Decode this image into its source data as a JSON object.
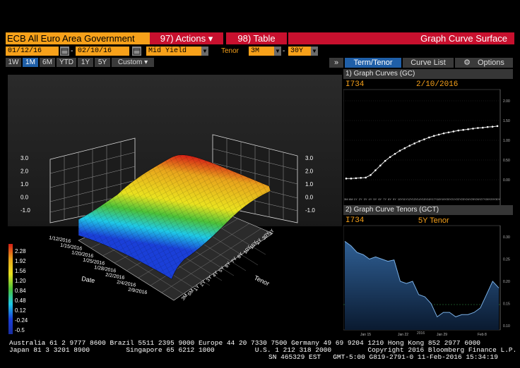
{
  "toolbar": {
    "security": "ECB All Euro Area Government",
    "actions_label": "97) Actions ▾",
    "table_label": "98) Table",
    "title": "Graph Curve Surface"
  },
  "params": {
    "start_date": "01/12/16",
    "end_date": "02/10/16",
    "field": "Mid Yield",
    "tenor_label": "Tenor",
    "tenor_from": "3M",
    "tenor_to": "30Y"
  },
  "periods": [
    "1W",
    "1M",
    "6M",
    "YTD",
    "1Y",
    "5Y",
    "Custom ▾"
  ],
  "active_period": "1M",
  "right_tabs": {
    "collapse": "»",
    "term_tenor": "Term/Tenor",
    "curve_list": "Curve List",
    "options": "Options"
  },
  "panel1": {
    "header": "1) Graph Curves (GC)",
    "curve": "I734",
    "date": "2/10/2016",
    "y_ticks": [
      "2.00",
      "1.50",
      "1.00",
      "0.50",
      "0.00"
    ],
    "x_ticks": [
      "3M",
      "6M",
      "1Y",
      "2Y",
      "3Y",
      "4Y",
      "5Y",
      "6Y",
      "7Y",
      "8Y",
      "9Y",
      "10Y",
      "11Y",
      "12Y",
      "13Y",
      "14Y",
      "15Y",
      "16Y",
      "17Y",
      "18Y",
      "19Y",
      "20Y",
      "21Y",
      "22Y",
      "23Y",
      "24Y",
      "25Y",
      "26Y",
      "27Y",
      "28Y",
      "29Y",
      "30Y"
    ]
  },
  "panel2": {
    "header": "2) Graph Curve Tenors (GCT)",
    "curve": "I734",
    "tenor": "5Y Tenor",
    "y_ticks": [
      "0.30",
      "0.25",
      "0.20",
      "0.15",
      "0.10"
    ],
    "x_ticks": [
      "Jan 15",
      "Jan 22",
      "Jan 29",
      "Feb 8"
    ],
    "year_label": "2016"
  },
  "surface": {
    "z_ticks": [
      "3.0",
      "2.0",
      "1.0",
      "0.0",
      "-1.0"
    ],
    "date_ticks": [
      "1/12/2016",
      "1/15/2016",
      "1/20/2016",
      "1/25/2016",
      "1/28/2016",
      "2/2/2016",
      "2/4/2016",
      "2/9/2016"
    ],
    "date_axis_label": "Date",
    "tenor_ticks": [
      "3Y",
      "30Y",
      "2Y",
      "15Y",
      "10Y",
      "8Y",
      "7Y",
      "6Y",
      "5Y",
      "4Y",
      "3Y",
      "2Y",
      "1Y",
      "6M",
      "3M"
    ],
    "tenor_axis_label": "Tenor",
    "legend": [
      "2.28",
      "1.92",
      "1.56",
      "1.20",
      "0.84",
      "0.48",
      "0.12",
      "-0.24",
      "-0.5"
    ],
    "colors": {
      "high": "#d51e16",
      "mid_high": "#e9e21f",
      "mid": "#4cc23a",
      "mid_low": "#1fc9e6",
      "low": "#1a3fd8"
    }
  },
  "footer": {
    "line1": "Australia 61 2 9777 8600 Brazil 5511 2395 9000 Europe 44 20 7330 7500 Germany 49 69 9204 1210 Hong Kong 852 2977 6000",
    "line2": "Japan 81 3 3201 8900         Singapore 65 6212 1000          U.S. 1 212 318 2000         Copyright 2016 Bloomberg Finance L.P.",
    "line3": "SN 465329 EST   GMT-5:00 G819-2791-0 11-Feb-2016 15:34:19"
  }
}
